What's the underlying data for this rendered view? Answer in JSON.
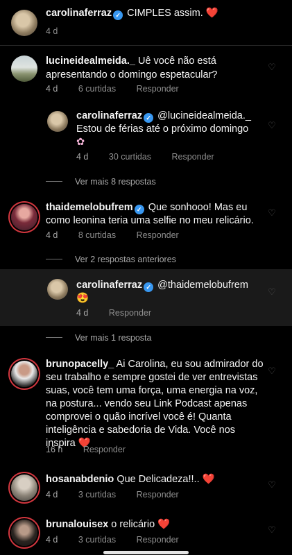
{
  "caption": {
    "username": "carolinaferraz",
    "text": "CIMPLES assim.",
    "heart": "❤️",
    "time": "4 d"
  },
  "comments": [
    {
      "username": "lucineidealmeida._",
      "text_line1": "Uê você não está",
      "text_line2": "apresentando o domingo espetacular?",
      "time": "4 d",
      "likes": "6 curtidas",
      "reply": "Responder"
    },
    {
      "username": "carolinaferraz",
      "mention": "@lucineidealmeida._",
      "text_line1": "Estou de férias até o próximo domingo",
      "emoji": "✿",
      "time": "4 d",
      "likes": "30 curtidas",
      "reply": "Responder"
    },
    {
      "username": "thaidemelobufrem",
      "text_line1": "Que sonhooo! Mas eu",
      "text_line2": "como leonina teria uma selfie no meu relicário.",
      "time": "4 d",
      "likes": "8 curtidas",
      "reply": "Responder"
    },
    {
      "username": "carolinaferraz",
      "mention": "@thaidemelobufrem",
      "emoji": "😍",
      "time": "4 d",
      "reply": "Responder"
    },
    {
      "username": "brunopacelly_",
      "text_lines": [
        "Ai Carolina, eu sou admirador do",
        "seu trabalho e sempre gostei de ver entrevistas",
        "suas, você tem uma força, uma energia na voz,",
        "na postura... vendo seu Link Podcast apenas",
        "comprovei o quão incrível você é! Quanta",
        "inteligência e sabedoria de Vida. Você nos",
        "inspira"
      ],
      "heart": "❤️",
      "time": "16 h",
      "reply": "Responder"
    },
    {
      "username": "hosanabdenio",
      "text_line1": "Que Delicadeza!!..",
      "heart": "❤️",
      "time": "4 d",
      "likes": "3 curtidas",
      "reply": "Responder"
    },
    {
      "username": "brunalouisex",
      "text_line1": "o relicário",
      "heart": "❤️",
      "time": "4 d",
      "likes": "3 curtidas",
      "reply": "Responder"
    }
  ],
  "view_more_1": "Ver mais 8 respostas",
  "view_prev": "Ver 2 respostas anteriores",
  "view_more_2": "Ver mais 1 resposta",
  "colors": {
    "background": "#000000",
    "highlight": "#1a1a1a",
    "verified": "#3897f0",
    "heart": "#ed4956",
    "meta": "#8e8e8e"
  },
  "icons": [
    "verified-badge-icon",
    "heart-like-icon",
    "avatar-image"
  ]
}
